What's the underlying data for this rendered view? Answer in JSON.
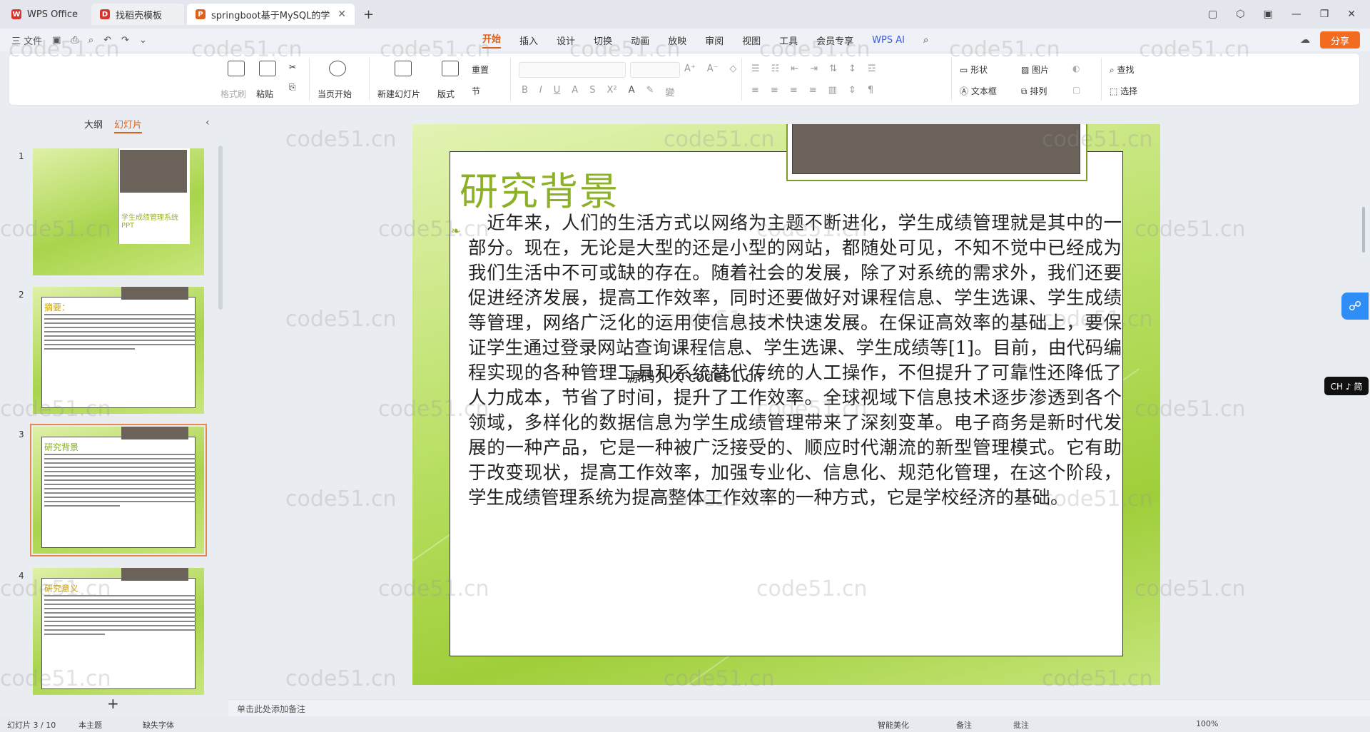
{
  "tabs": [
    {
      "title": "WPS Office",
      "icon": "W"
    },
    {
      "title": "找稻壳模板",
      "icon": "D"
    },
    {
      "title": "springboot基于MySQL的学",
      "icon": "P"
    }
  ],
  "menu": {
    "file": "三 文件",
    "tabs": [
      "开始",
      "插入",
      "设计",
      "切换",
      "动画",
      "放映",
      "审阅",
      "视图",
      "工具",
      "会员专享"
    ],
    "wps_ai": "WPS AI",
    "share": "分享"
  },
  "ribbon": {
    "format_painter": "格式刷",
    "paste": "粘贴",
    "start_from_current": "当页开始",
    "new_slide": "新建幻灯片",
    "layout": "版式",
    "reset": "重置",
    "section": "节",
    "shape": "形状",
    "picture": "图片",
    "textbox": "文本框",
    "arrange": "排列",
    "find": "查找",
    "select": "选择"
  },
  "left_panel": {
    "tab_outline": "大纲",
    "tab_slides": "幻灯片",
    "slides": [
      {
        "num": "1",
        "title": "学生成绩管理系统PPT"
      },
      {
        "num": "2",
        "title": "摘要："
      },
      {
        "num": "3",
        "title": "研究背景"
      },
      {
        "num": "4",
        "title": "研究意义"
      }
    ]
  },
  "slide": {
    "title": "研究背景",
    "body": "　近年来，人们的生活方式以网络为主题不断进化，学生成绩管理就是其中的一部分。现在，无论是大型的还是小型的网站，都随处可见，不知不觉中已经成为我们生活中不可或缺的存在。随着社会的发展，除了对系统的需求外，我们还要促进经济发展，提高工作效率，同时还要做好对课程信息、学生选课、学生成绩等管理，网络广泛化的运用使信息技术快速发展。在保证高效率的基础上，要保证学生通过登录网站查询课程信息、学生选课、学生成绩等[1]。目前，由代码编程实现的各种管理工具和系统替代传统的人工操作，不但提升了可靠性还降低了人力成本，节省了时间，提升了工作效率。全球视域下信息技术逐步渗透到各个领域，多样化的数据信息为学生成绩管理带来了深刻变革。电子商务是新时代发展的一种产品，它是一种被广泛接受的、顺应时代潮流的新型管理模式。它有助于改变现状，提高工作效率，加强专业化、信息化、规范化管理，在这个阶段，学生成绩管理系统为提高整体工作效率的一种方式，它是学校经济的基础。",
    "watermark_center": "源码久久 code51.cn"
  },
  "notes_placeholder": "单击此处添加备注",
  "ime": "CH ♪ 简",
  "watermark": "code51.cn",
  "status": {
    "slide_info": "幻灯片 3 / 10",
    "theme": "本主题",
    "font_missing": "缺失字体",
    "smart_beautify": "智能美化",
    "notes": "备注",
    "comments": "批注",
    "zoom": "100%"
  }
}
